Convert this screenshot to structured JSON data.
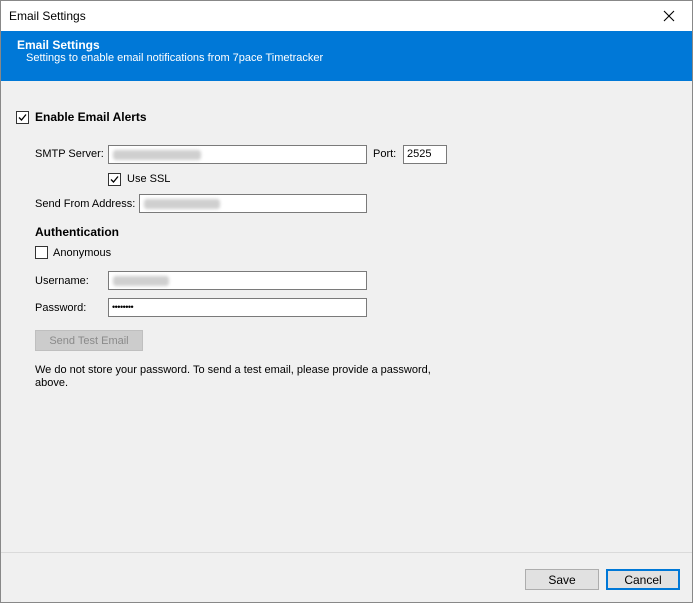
{
  "window": {
    "title": "Email Settings"
  },
  "header": {
    "title": "Email Settings",
    "subtitle": "Settings to enable email notifications from 7pace Timetracker"
  },
  "form": {
    "enable_alerts": {
      "label": "Enable Email Alerts",
      "checked": true
    },
    "smtp_server": {
      "label": "SMTP Server:",
      "value": ""
    },
    "port": {
      "label": "Port:",
      "value": "2525"
    },
    "use_ssl": {
      "label": "Use SSL",
      "checked": true
    },
    "send_from": {
      "label": "Send From Address:",
      "value": ""
    },
    "authentication_heading": "Authentication",
    "anonymous": {
      "label": "Anonymous",
      "checked": false
    },
    "username": {
      "label": "Username:",
      "value": ""
    },
    "password": {
      "label": "Password:",
      "value": "••••••••"
    },
    "send_test_button": "Send Test Email",
    "note": "We do not store your password. To send a test email, please provide a password, above."
  },
  "footer": {
    "save_label": "Save",
    "cancel_label": "Cancel"
  },
  "colors": {
    "accent": "#0078d7"
  },
  "icons": {
    "close": "close-icon",
    "check": "checkmark-icon"
  }
}
